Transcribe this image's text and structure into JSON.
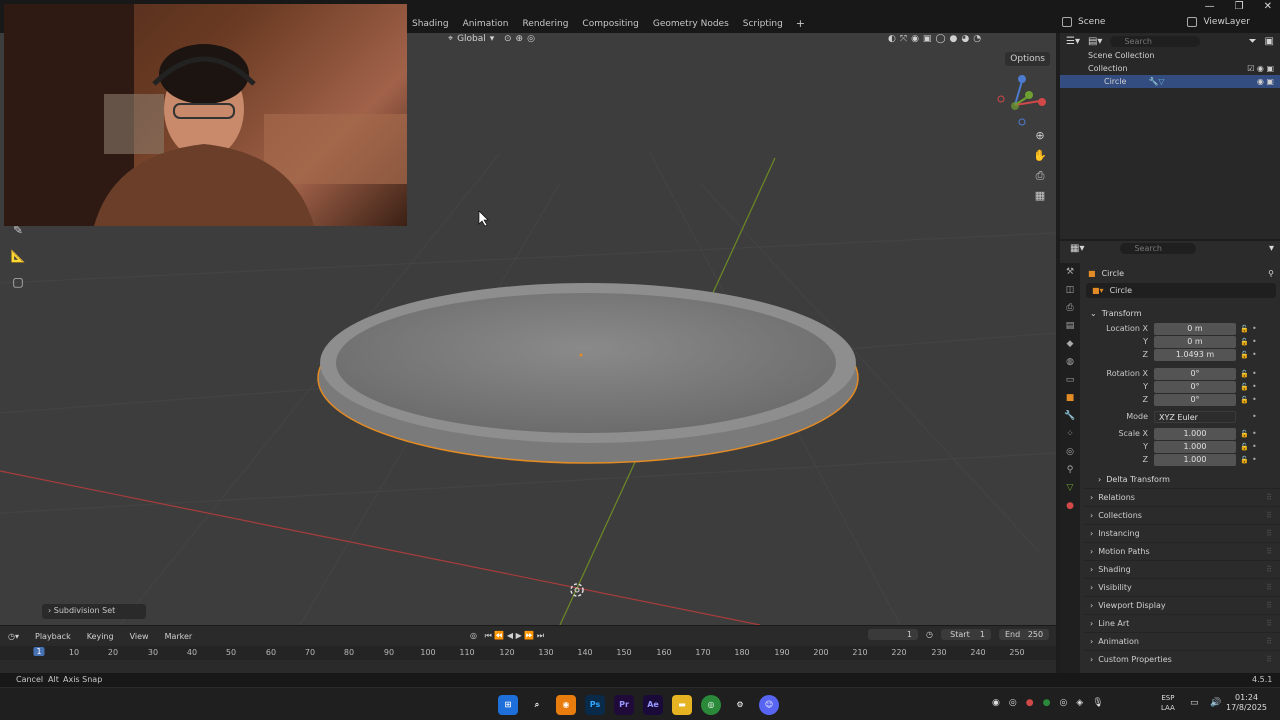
{
  "workspace_tabs": [
    "Shading",
    "Animation",
    "Rendering",
    "Compositing",
    "Geometry Nodes",
    "Scripting"
  ],
  "workspace_add": "+",
  "scene": {
    "label": "Scene",
    "view_layer": "ViewLayer"
  },
  "window_controls": [
    "—",
    "❐",
    "✕"
  ],
  "viewport": {
    "orientation": "Global",
    "options_label": "Options",
    "operator_panel": "Subdivision Set",
    "selection_color": "#e38b24",
    "x_axis_color": "#c84a4a",
    "y_axis_color": "#7c9c2c"
  },
  "outliner": {
    "search_placeholder": "Search",
    "rows": [
      "Scene Collection",
      "Collection",
      "Circle"
    ]
  },
  "properties": {
    "search_placeholder": "Search",
    "object_name": "Circle",
    "name_field": "Circle",
    "transform_label": "Transform",
    "location_label": "Location X",
    "loc": [
      "0 m",
      "0 m",
      "1.0493 m"
    ],
    "rotation_label": "Rotation X",
    "rot": [
      "0°",
      "0°",
      "0°"
    ],
    "mode_label": "Mode",
    "mode_value": "XYZ Euler",
    "scale_label": "Scale X",
    "scale": [
      "1.000",
      "1.000",
      "1.000"
    ],
    "y_label": "Y",
    "z_label": "Z",
    "delta_label": "Delta Transform",
    "sections": [
      "Relations",
      "Collections",
      "Instancing",
      "Motion Paths",
      "Shading",
      "Visibility",
      "Viewport Display",
      "Line Art",
      "Animation",
      "Custom Properties"
    ]
  },
  "timeline": {
    "menus": [
      "Playback",
      "Keying",
      "View",
      "Marker"
    ],
    "current_frame": "1",
    "start_label": "Start",
    "start_value": "1",
    "end_label": "End",
    "end_value": "250",
    "ruler_current": "1",
    "ticks": [
      "10",
      "20",
      "30",
      "40",
      "50",
      "60",
      "70",
      "80",
      "90",
      "100",
      "110",
      "120",
      "130",
      "140",
      "150",
      "160",
      "170",
      "180",
      "190",
      "200",
      "210",
      "220",
      "230",
      "240",
      "250"
    ]
  },
  "statusbar": {
    "cancel": "Cancel",
    "alt_key": "Alt",
    "axis_snap": "Axis Snap",
    "version": "4.5.1"
  },
  "taskbar": {
    "lang": [
      "ESP",
      "LAA"
    ],
    "time": "01:24",
    "date": "17/8/2025"
  }
}
